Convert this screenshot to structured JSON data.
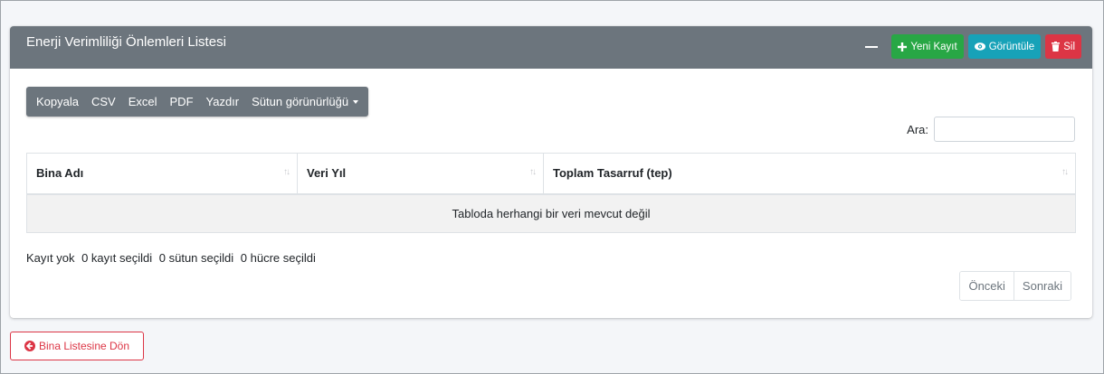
{
  "card": {
    "title": "Enerji Verimliliği Önlemleri Listesi",
    "buttons": {
      "new": "Yeni Kayıt",
      "view": "Görüntüle",
      "delete": "Sil"
    }
  },
  "export_buttons": [
    "Kopyala",
    "CSV",
    "Excel",
    "PDF",
    "Yazdır",
    "Sütun görünürlüğü"
  ],
  "search": {
    "label": "Ara:",
    "value": ""
  },
  "table": {
    "columns": [
      "Bina Adı",
      "Veri Yıl",
      "Toplam Tasarruf (tep)"
    ],
    "empty_message": "Tabloda herhangi bir veri mevcut değil"
  },
  "info": {
    "records": "Kayıt yok",
    "rows_selected": "0 kayıt seçildi",
    "columns_selected": "0 sütun seçildi",
    "cells_selected": "0 hücre seçildi"
  },
  "pagination": {
    "prev": "Önceki",
    "next": "Sonraki"
  },
  "back_button": "Bina Listesine Dön",
  "colors": {
    "header": "#6c757d",
    "success": "#28a745",
    "info": "#17a2b8",
    "danger": "#dc3545"
  },
  "icons": {
    "collapse": "minus-icon",
    "new": "plus-icon",
    "view": "eye-icon",
    "delete": "trash-icon",
    "sort": "sort-icon",
    "back": "arrow-circle-left-icon"
  }
}
